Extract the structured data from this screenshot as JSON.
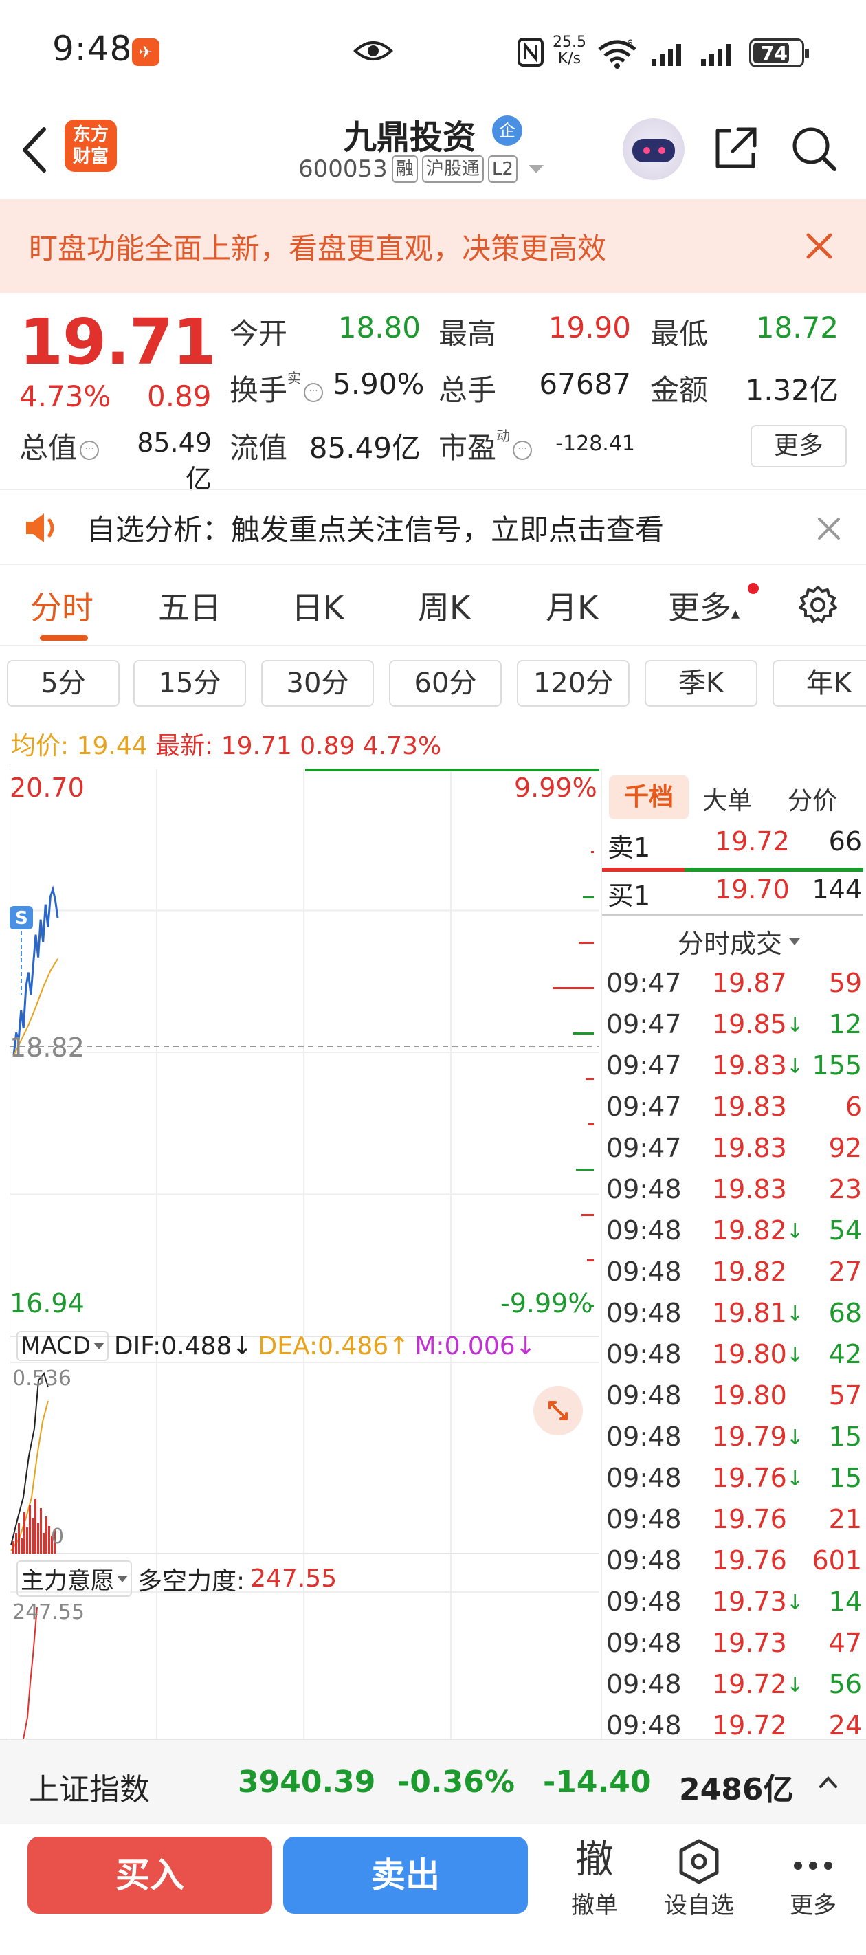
{
  "status": {
    "time": "9:48",
    "netspeed_value": "25.5",
    "netspeed_unit": "K/s",
    "network": "6",
    "battery": "74"
  },
  "header": {
    "logo_line1": "东方",
    "logo_line2": "财富",
    "stock_name": "九鼎投资",
    "badge": "企",
    "code": "600053",
    "tags": [
      "融",
      "沪股通",
      "L2"
    ]
  },
  "banner": {
    "text": "盯盘功能全面上新，看盘更直观，决策更高效"
  },
  "quote": {
    "price": "19.71",
    "change_pct": "4.73%",
    "change": "0.89",
    "labels": {
      "open": "今开",
      "high": "最高",
      "low": "最低",
      "turnover": "换手",
      "volume": "总手",
      "amount": "金额",
      "mktcap": "总值",
      "float_cap": "流值",
      "pe": "市盈"
    },
    "sup_turnover": "实",
    "sup_pe": "动",
    "values": {
      "open": "18.80",
      "high": "19.90",
      "low": "18.72",
      "turnover": "5.90%",
      "volume": "67687",
      "amount": "1.32亿",
      "mktcap": "85.49亿",
      "float_cap": "85.49亿",
      "pe": "-128.41"
    },
    "more": "更多"
  },
  "notice": {
    "text": "自选分析：触发重点关注信号，立即点击查看"
  },
  "main_tabs": [
    "分时",
    "五日",
    "日K",
    "周K",
    "月K",
    "更多"
  ],
  "periods": [
    "5分",
    "15分",
    "30分",
    "60分",
    "120分",
    "季K",
    "年K"
  ],
  "avg_line": {
    "avg_label": "均价:",
    "avg_value": "19.44",
    "last_label": "最新:",
    "last_value": "19.71",
    "last_change": "0.89",
    "last_pct": "4.73%"
  },
  "chart_data": {
    "type": "line",
    "title": "",
    "price_top": "20.70",
    "price_base": "18.82",
    "price_bottom": "16.94",
    "pct_top": "9.99%",
    "pct_bottom": "-9.99%",
    "ylim": [
      16.94,
      20.7
    ],
    "s_marker": "S",
    "series": [
      {
        "x": [
          "09:30",
          "09:31",
          "09:32",
          "09:33",
          "09:34",
          "09:35",
          "09:36",
          "09:37",
          "09:38",
          "09:39",
          "09:40",
          "09:41",
          "09:42",
          "09:43",
          "09:44",
          "09:45",
          "09:46",
          "09:47",
          "09:48"
        ],
        "values": [
          18.8,
          18.95,
          18.9,
          19.1,
          18.98,
          19.25,
          19.35,
          19.2,
          19.4,
          19.6,
          19.45,
          19.7,
          19.55,
          19.8,
          19.65,
          19.85,
          19.9,
          19.83,
          19.71
        ]
      },
      {
        "x": [
          "09:30",
          "09:33",
          "09:36",
          "09:39",
          "09:42",
          "09:45",
          "09:48"
        ],
        "values": [
          18.8,
          18.9,
          19.0,
          19.12,
          19.25,
          19.36,
          19.44
        ]
      }
    ],
    "macd": {
      "label": "MACD",
      "dif": "DIF:0.488",
      "dea": "DEA:0.486",
      "m": "M:0.006",
      "top": "0.536",
      "zero": "0"
    },
    "zly": {
      "label": "主力意愿",
      "strength_label": "多空力度:",
      "strength_value": "247.55",
      "top": "247.55"
    }
  },
  "side": {
    "tabs": [
      "千档",
      "大单",
      "分价"
    ],
    "ask1": {
      "label": "卖1",
      "price": "19.72",
      "vol": "66"
    },
    "bid1": {
      "label": "买1",
      "price": "19.70",
      "vol": "144"
    },
    "ticks_title": "分时成交",
    "ticks": [
      {
        "t": "09:47",
        "p": "19.87",
        "a": "",
        "v": "59",
        "c": "red"
      },
      {
        "t": "09:47",
        "p": "19.85",
        "a": "↓",
        "v": "12",
        "c": "green"
      },
      {
        "t": "09:47",
        "p": "19.83",
        "a": "↓",
        "v": "155",
        "c": "green"
      },
      {
        "t": "09:47",
        "p": "19.83",
        "a": "",
        "v": "6",
        "c": "red"
      },
      {
        "t": "09:47",
        "p": "19.83",
        "a": "",
        "v": "92",
        "c": "red"
      },
      {
        "t": "09:48",
        "p": "19.83",
        "a": "",
        "v": "23",
        "c": "red"
      },
      {
        "t": "09:48",
        "p": "19.82",
        "a": "↓",
        "v": "54",
        "c": "green"
      },
      {
        "t": "09:48",
        "p": "19.82",
        "a": "",
        "v": "27",
        "c": "red"
      },
      {
        "t": "09:48",
        "p": "19.81",
        "a": "↓",
        "v": "68",
        "c": "green"
      },
      {
        "t": "09:48",
        "p": "19.80",
        "a": "↓",
        "v": "42",
        "c": "green"
      },
      {
        "t": "09:48",
        "p": "19.80",
        "a": "",
        "v": "57",
        "c": "red"
      },
      {
        "t": "09:48",
        "p": "19.79",
        "a": "↓",
        "v": "15",
        "c": "green"
      },
      {
        "t": "09:48",
        "p": "19.76",
        "a": "↓",
        "v": "15",
        "c": "green"
      },
      {
        "t": "09:48",
        "p": "19.76",
        "a": "",
        "v": "21",
        "c": "red"
      },
      {
        "t": "09:48",
        "p": "19.76",
        "a": "",
        "v": "601",
        "c": "red"
      },
      {
        "t": "09:48",
        "p": "19.73",
        "a": "↓",
        "v": "14",
        "c": "green"
      },
      {
        "t": "09:48",
        "p": "19.73",
        "a": "",
        "v": "47",
        "c": "red"
      },
      {
        "t": "09:48",
        "p": "19.72",
        "a": "↓",
        "v": "56",
        "c": "green"
      },
      {
        "t": "09:48",
        "p": "19.72",
        "a": "",
        "v": "24",
        "c": "red"
      }
    ]
  },
  "index_bar": {
    "name": "上证指数",
    "value": "3940.39",
    "pct": "-0.36%",
    "chg": "-14.40",
    "amount": "2486亿"
  },
  "toolbar": {
    "buy": "买入",
    "sell": "卖出",
    "cancel_icon": "撤",
    "cancel": "撤单",
    "watch": "设自选",
    "more": "更多"
  },
  "colors": {
    "up": "#e0312c",
    "down": "#1c9a2e",
    "accent": "#e85a1c",
    "avg": "#e8a21c",
    "price_line": "#2a67c9",
    "buy_button": "#e8524a",
    "sell_button": "#3f8ff0"
  }
}
